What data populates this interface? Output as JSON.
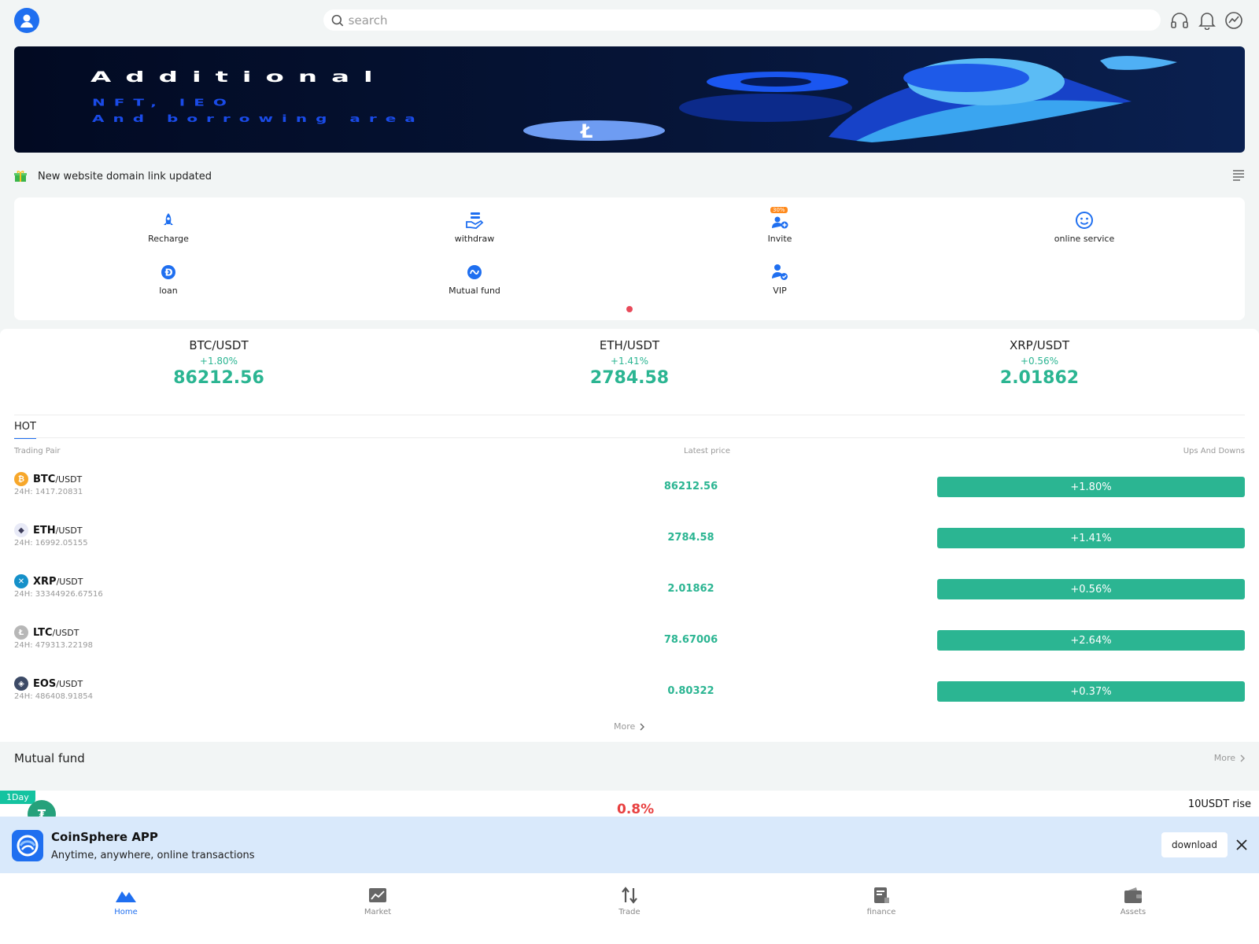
{
  "header": {
    "search_placeholder": "search"
  },
  "banner": {
    "line1": "Additional",
    "line2": "NFT, IEO",
    "line3": "And borrowing area"
  },
  "notice": {
    "text": "New website domain link updated"
  },
  "quick_menu": [
    {
      "label": "Recharge",
      "icon": "rocket-icon"
    },
    {
      "label": "withdraw",
      "icon": "withdraw-hand-icon"
    },
    {
      "label": "Invite",
      "icon": "invite-user-icon",
      "badge": "30%"
    },
    {
      "label": "online service",
      "icon": "smile-chat-icon"
    },
    {
      "label": "loan",
      "icon": "dash-coin-icon"
    },
    {
      "label": "Mutual fund",
      "icon": "fund-icon"
    },
    {
      "label": "VIP",
      "icon": "vip-user-icon"
    }
  ],
  "tickers": [
    {
      "pair": "BTC/USDT",
      "change": "+1.80%",
      "price": "86212.56"
    },
    {
      "pair": "ETH/USDT",
      "change": "+1.41%",
      "price": "2784.58"
    },
    {
      "pair": "XRP/USDT",
      "change": "+0.56%",
      "price": "2.01862"
    }
  ],
  "hot": {
    "tab_label": "HOT",
    "col_pair": "Trading Pair",
    "col_price": "Latest price",
    "col_change": "Ups And Downs",
    "rows": [
      {
        "base": "BTC",
        "quote": "/USDT",
        "vol": "24H: 1417.20831",
        "price": "86212.56",
        "change": "+1.80%",
        "color": "#f7a72a",
        "glyph": "₿"
      },
      {
        "base": "ETH",
        "quote": "/USDT",
        "vol": "24H: 16992.05155",
        "price": "2784.58",
        "change": "+1.41%",
        "color": "#e8eaf7",
        "glyph": "◆"
      },
      {
        "base": "XRP",
        "quote": "/USDT",
        "vol": "24H: 33344926.67516",
        "price": "2.01862",
        "change": "+0.56%",
        "color": "#1590c9",
        "glyph": "✕"
      },
      {
        "base": "LTC",
        "quote": "/USDT",
        "vol": "24H: 479313.22198",
        "price": "78.67006",
        "change": "+2.64%",
        "color": "#b7b7b7",
        "glyph": "Ł"
      },
      {
        "base": "EOS",
        "quote": "/USDT",
        "vol": "24H: 486408.91854",
        "price": "0.80322",
        "change": "+0.37%",
        "color": "#3c4a66",
        "glyph": "◈"
      }
    ],
    "more_label": "More"
  },
  "mutual_fund": {
    "title": "Mutual fund",
    "more_label": "More",
    "tag": "1Day",
    "rate": "0.8%",
    "rise": "10USDT rise",
    "coin_glyph": "₮"
  },
  "app_banner": {
    "name": "CoinSphere APP",
    "desc": "Anytime, anywhere, online transactions",
    "download_label": "download"
  },
  "bottom_nav": [
    {
      "label": "Home",
      "icon": "home-mountain-icon",
      "active": true
    },
    {
      "label": "Market",
      "icon": "market-chart-icon",
      "active": false
    },
    {
      "label": "Trade",
      "icon": "trade-arrows-icon",
      "active": false
    },
    {
      "label": "finance",
      "icon": "finance-doc-icon",
      "active": false
    },
    {
      "label": "Assets",
      "icon": "wallet-icon",
      "active": false
    }
  ],
  "colors": {
    "accent": "#1f6ff0",
    "up": "#2bb592",
    "down": "#e84040"
  }
}
